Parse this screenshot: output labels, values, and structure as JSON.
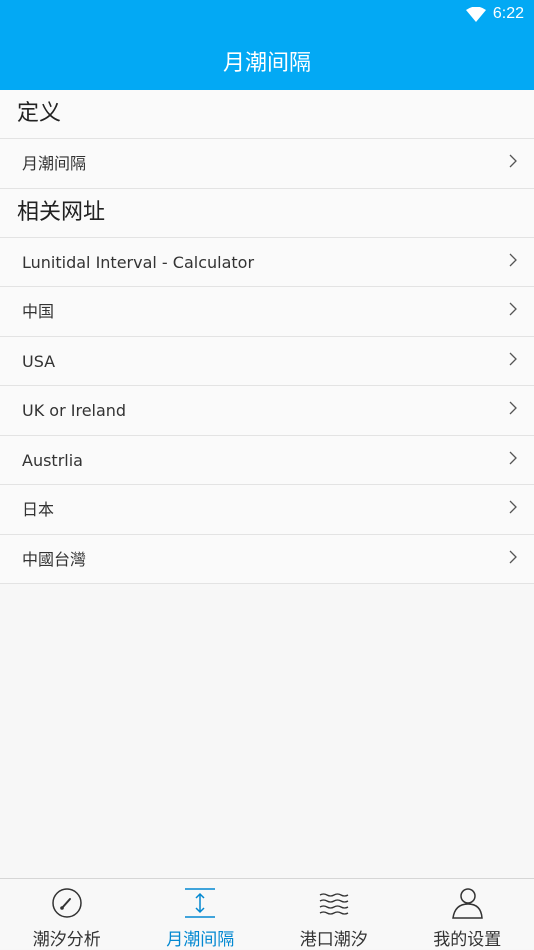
{
  "status_bar": {
    "time": "6:22",
    "wifi_icon": "wifi-icon"
  },
  "app_bar": {
    "title": "月潮间隔"
  },
  "sections": [
    {
      "header": "定义",
      "items": [
        {
          "label": "月潮间隔"
        }
      ]
    },
    {
      "header": "相关网址",
      "items": [
        {
          "label": "Lunitidal Interval - Calculator"
        },
        {
          "label": "中国"
        },
        {
          "label": "USA"
        },
        {
          "label": "UK or Ireland"
        },
        {
          "label": "Austrlia"
        },
        {
          "label": "日本"
        },
        {
          "label": "中國台灣"
        }
      ]
    }
  ],
  "tabs": [
    {
      "label": "潮汐分析",
      "icon": "gauge-icon",
      "active": false
    },
    {
      "label": "月潮间隔",
      "icon": "vertical-interval-icon",
      "active": true
    },
    {
      "label": "港口潮汐",
      "icon": "waves-icon",
      "active": false
    },
    {
      "label": "我的设置",
      "icon": "user-icon",
      "active": false
    }
  ],
  "colors": {
    "primary": "#03a9f4",
    "active_tab": "#0288d1",
    "inactive_tab": "#333333"
  }
}
